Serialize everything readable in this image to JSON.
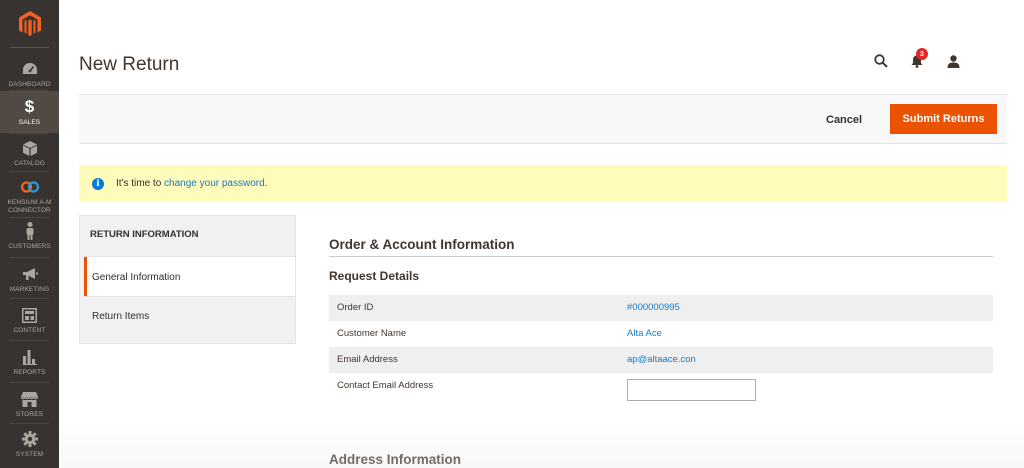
{
  "sidebar": {
    "items": [
      {
        "label": "DASHBOARD",
        "icon": "dashboard-icon"
      },
      {
        "label": "SALES",
        "icon": "dollar-icon",
        "active": true
      },
      {
        "label": "CATALOG",
        "icon": "cube-icon"
      },
      {
        "label": "KENSIUM A-M CONNECTOR",
        "icon": "connector-icon"
      },
      {
        "label": "CUSTOMERS",
        "icon": "person-icon"
      },
      {
        "label": "MARKETING",
        "icon": "megaphone-icon"
      },
      {
        "label": "CONTENT",
        "icon": "layout-icon"
      },
      {
        "label": "REPORTS",
        "icon": "bar-chart-icon"
      },
      {
        "label": "STORES",
        "icon": "store-icon"
      },
      {
        "label": "SYSTEM",
        "icon": "gear-icon"
      }
    ]
  },
  "header": {
    "title": "New Return",
    "notification_count": "3"
  },
  "actions": {
    "cancel_label": "Cancel",
    "submit_label": "Submit Returns"
  },
  "notice": {
    "prefix": "It's time to ",
    "link_text": "change your password",
    "suffix": "."
  },
  "tabs": {
    "title": "RETURN INFORMATION",
    "items": [
      {
        "label": "General Information",
        "active": true
      },
      {
        "label": "Return Items"
      }
    ]
  },
  "main": {
    "section_title": "Order & Account Information",
    "subsection_title": "Request Details",
    "rows": [
      {
        "label": "Order ID",
        "value": "#000000995"
      },
      {
        "label": "Customer Name",
        "value": "Alta Ace"
      },
      {
        "label": "Email Address",
        "value": "ap@altaace.con"
      },
      {
        "label": "Contact Email Address",
        "value": ""
      }
    ],
    "address_title": "Address Information"
  },
  "colors": {
    "sidebar_bg": "#373330",
    "accent": "#eb5202",
    "link": "#1979c3",
    "notice_bg": "#fffbbb"
  }
}
